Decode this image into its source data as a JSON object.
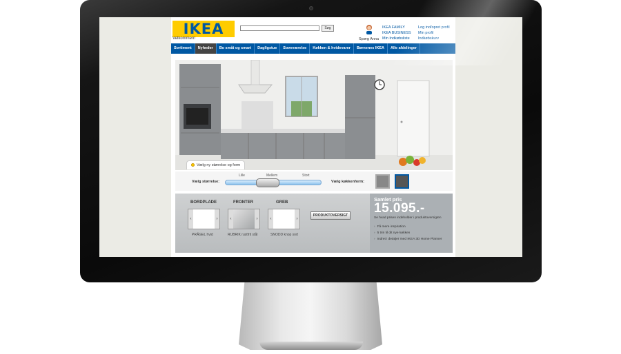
{
  "header": {
    "logo": "IKEA",
    "welcome": "Velkommen!",
    "search_button": "Søg",
    "ask_anna": "Spørg Anna",
    "family_links": [
      "IKEA FAMILY",
      "IKEA BUSINESS",
      "Min Indkøbsliste"
    ],
    "account_links": [
      "Log ind/opret profil",
      "Min profil",
      "Indkøbskurv"
    ]
  },
  "nav": {
    "items": [
      "Sortiment",
      "Nyheder",
      "Bo småt og smart",
      "Dagligstue",
      "Soveværelse",
      "Køkken & hvidevarer",
      "Børnenes IKEA",
      "Alle afdelinger"
    ]
  },
  "hero": {
    "tab_label": "Vælg ny størrelse og form"
  },
  "size_panel": {
    "label": "Vælg størrelse:",
    "options": [
      "Lille",
      "Mellem",
      "Stort"
    ],
    "selected": "Mellem",
    "shape_label": "Vælg køkkenform:"
  },
  "config": {
    "categories": [
      {
        "title": "BORDPLADE",
        "caption": "PRÄGEL hvid"
      },
      {
        "title": "FRONTER",
        "caption": "RUBRIK rustfrit stål"
      },
      {
        "title": "GREB",
        "caption": "SNODD knop sort"
      }
    ],
    "product_button": "PRODUKTOVERSIGT",
    "total_title": "Samlet pris",
    "total_price": "15.095.-",
    "total_sub": "Se hvad prisen indeholder i produktoversigten",
    "bullets": [
      "Få mere inspiration",
      "5 trin til dit nye køkken",
      "Indret i detaljer med IKEA 3D Home Planner"
    ]
  },
  "colors": {
    "ikea_blue": "#0058a3",
    "ikea_yellow": "#ffcc00"
  }
}
